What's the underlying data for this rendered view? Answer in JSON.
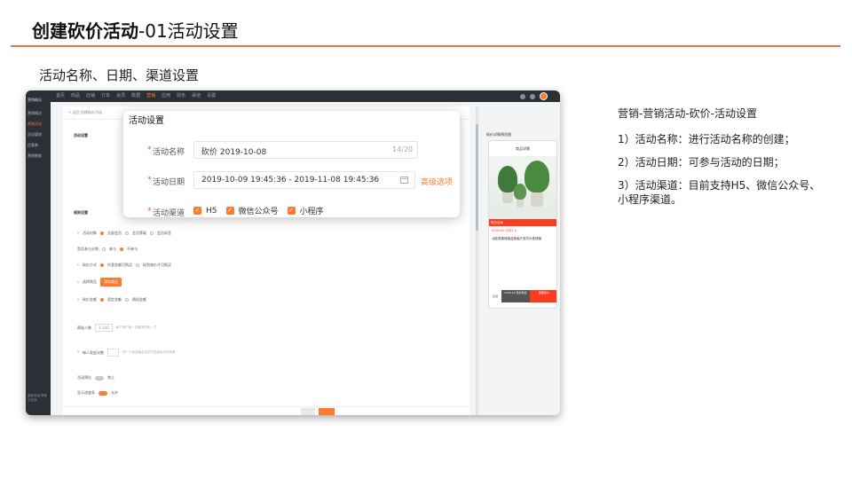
{
  "slide": {
    "title_bold": "创建砍价活动",
    "title_rest": "-01活动设置",
    "section_heading": "活动名称、日期、渠道设置"
  },
  "topbar": {
    "nav": [
      "首页",
      "商品",
      "店铺",
      "订单",
      "会员",
      "数据",
      "营销",
      "应用",
      "财务",
      "渠道",
      "设置"
    ],
    "active_index": 6
  },
  "sidebar": {
    "header": "营销概况",
    "items": [
      "营销概况",
      "营销活动",
      "活动管理",
      "优惠券",
      "营销数据"
    ],
    "active_index": 1,
    "footer": "客服电话 帮助与反馈"
  },
  "main": {
    "breadcrumb": "< 返回   创建砍价活动",
    "basic_section": "活动设置",
    "rule_section": "规则设置",
    "rows": {
      "target": "活动对象",
      "target_opts": [
        "全部会员",
        "会员等级",
        "会员标签"
      ],
      "repeat": "是否参与分销",
      "repeat_opts": [
        "参与",
        "不参与"
      ],
      "bargain": "砍价方式",
      "bargain_opts": [
        "任意金额可购买",
        "砍到底价才可购买"
      ],
      "goods": "选择商品",
      "goods_btn": "添加商品",
      "price": "砍价金额",
      "price_opts": [
        "固定金额",
        "随机金额"
      ],
      "helpers": "帮砍人数",
      "helpers_hint": "每个用户每一次最多可砍一刀",
      "times": "每人发起次数",
      "times_hint": "同一个商品每名会员可发起砍价的次数",
      "notice": "活动预告",
      "notice_state": "禁止",
      "show_progress": "显示进度条",
      "show_state": "允许"
    },
    "buttons": {
      "cancel": "取消",
      "save": "保存"
    }
  },
  "preview": {
    "label": "砍价详情预览图",
    "phone_title": "商品详情",
    "banner": "砍价活动",
    "price": "¥100.00  已砍1人",
    "desc": "北欧风格绿植盆栽客厅室内大型绿植",
    "actions": [
      "店铺",
      "¥100.00 原价购买",
      "我要砍价"
    ]
  },
  "popup": {
    "title": "活动设置",
    "name_label": "活动名称",
    "name_value": "砍价 2019-10-08",
    "name_count": "14/20",
    "date_label": "活动日期",
    "date_value": "2019-10-09 19:45:36 - 2019-11-08 19:45:36",
    "advanced": "高级选项",
    "channel_label": "活动渠道",
    "channels": [
      "H5",
      "微信公众号",
      "小程序"
    ]
  },
  "notes": {
    "heading": "营销-营销活动-砍价-活动设置",
    "items": [
      "1）活动名称：进行活动名称的创建；",
      "2）活动日期：可参与活动的日期；",
      "3）活动渠道：目前支持H5、微信公众号、小程序渠道。"
    ]
  },
  "colors": {
    "accent": "#ff7a2f",
    "rule": "#e8783a",
    "sidebar": "#2b2f36"
  }
}
